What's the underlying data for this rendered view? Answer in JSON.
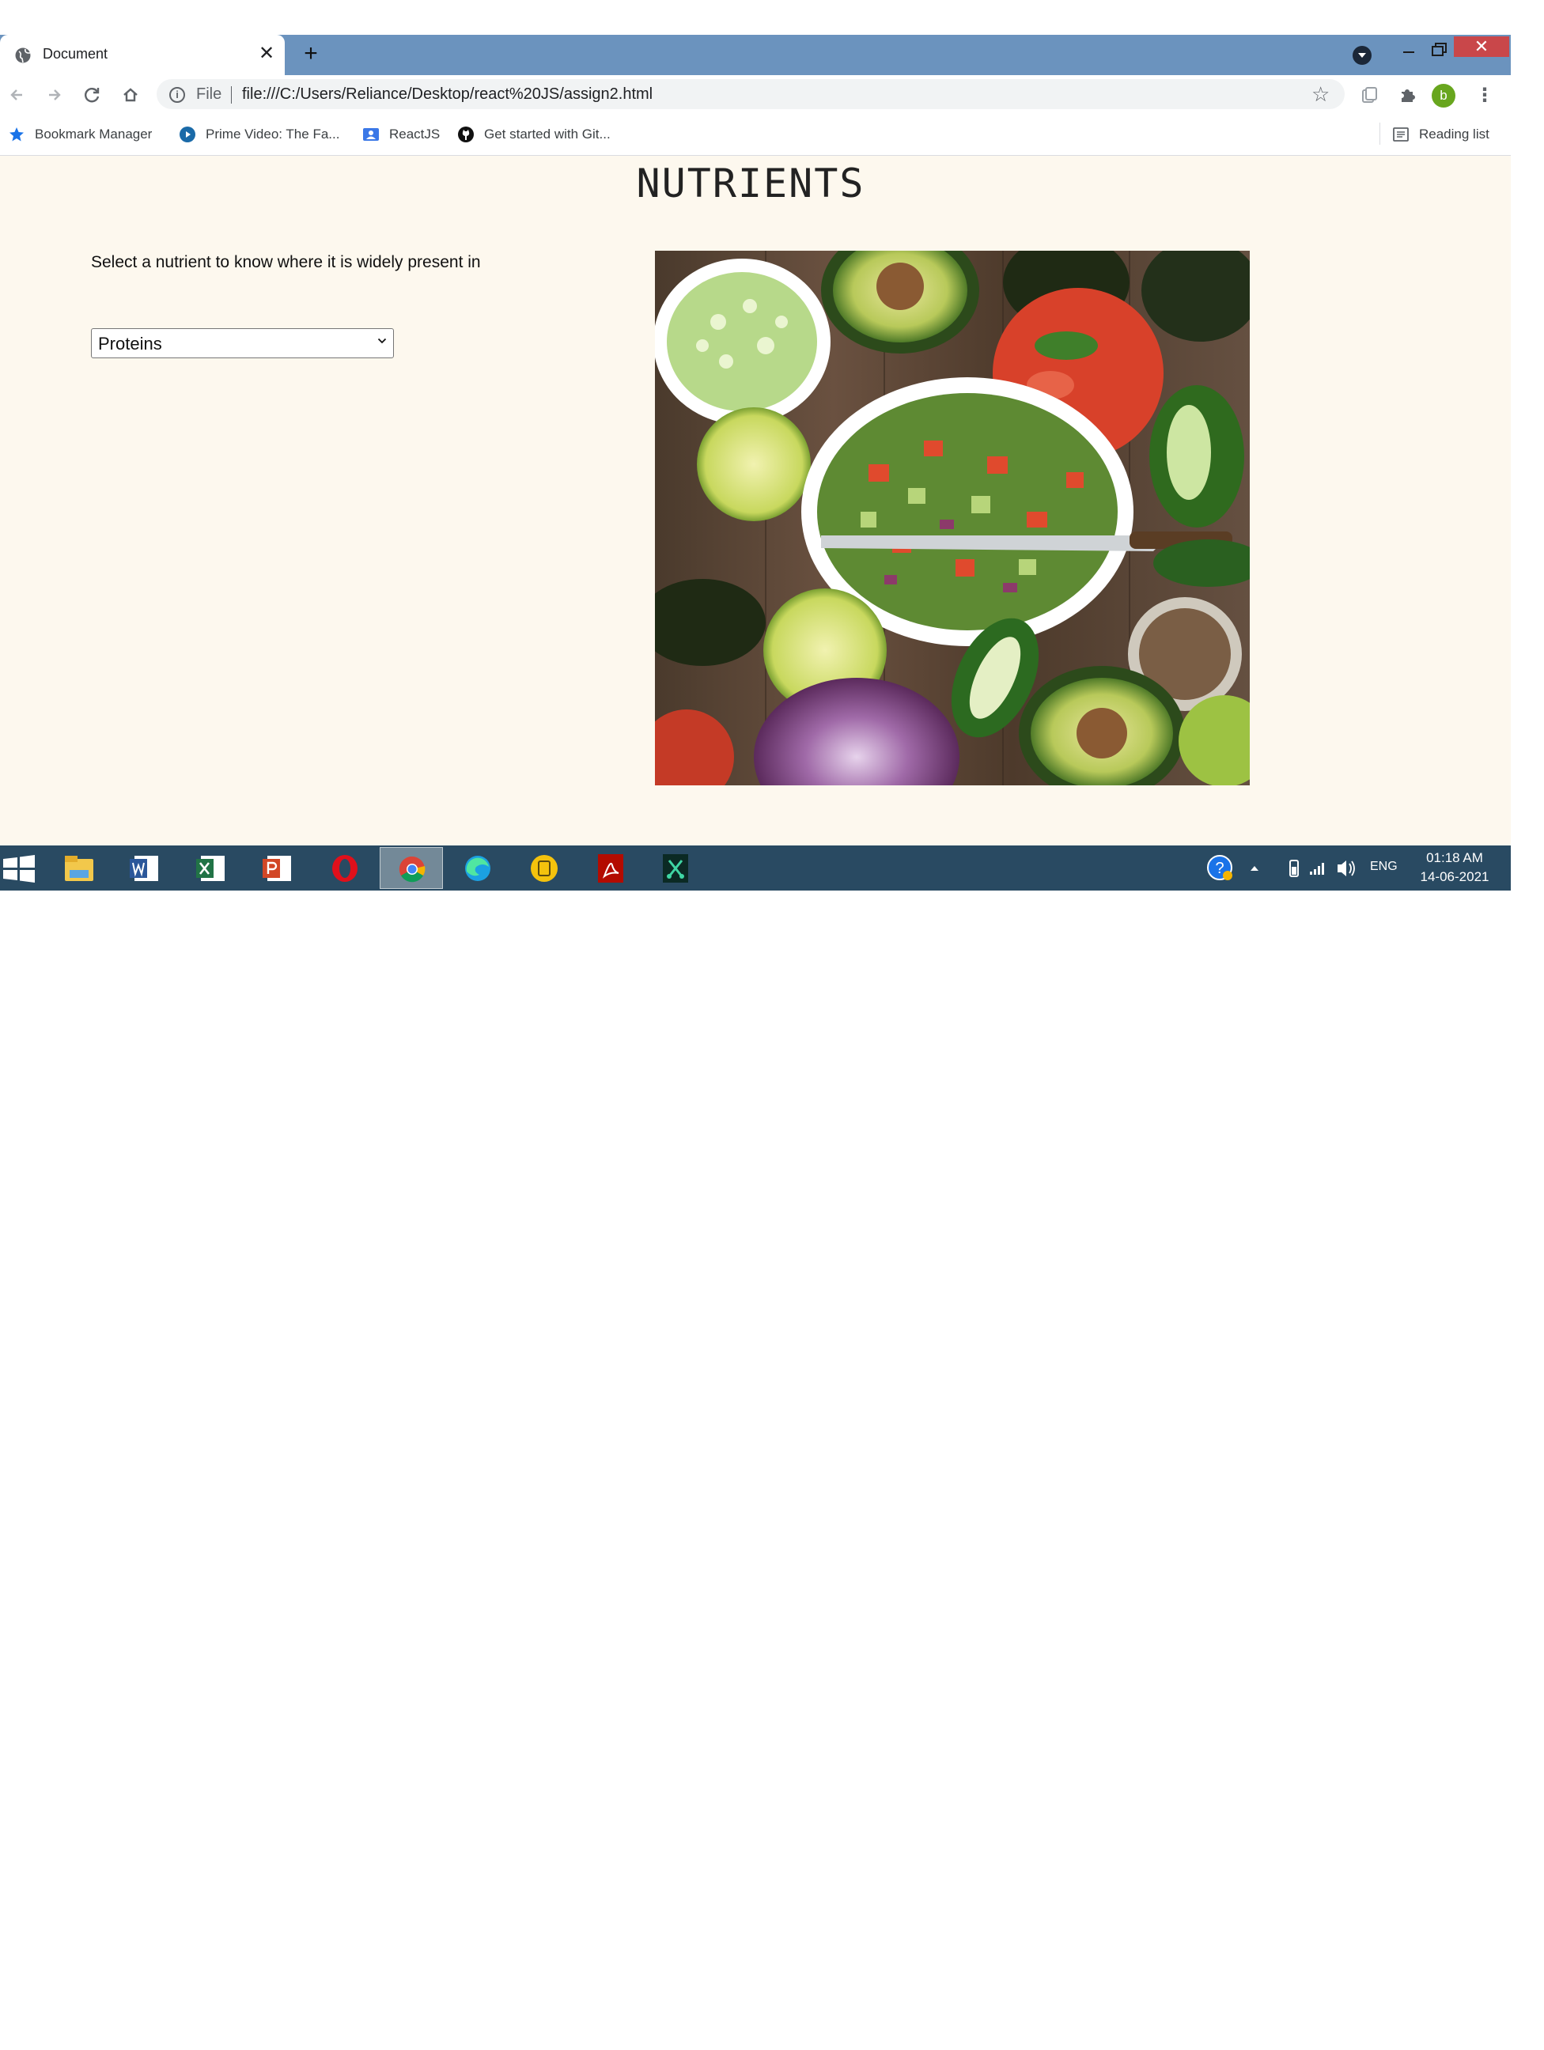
{
  "browser": {
    "tab": {
      "title": "Document",
      "close_glyph": "✕",
      "favicon": "globe-icon"
    },
    "new_tab_glyph": "+",
    "window_controls": {
      "close_glyph": "✕"
    },
    "toolbar": {
      "scheme": "File",
      "url": "file:///C:/Users/Reliance/Desktop/react%20JS/assign2.html",
      "info_glyph": "i",
      "star_glyph": "☆",
      "menu_glyph": "⋮",
      "profile_initial": "b"
    },
    "bookmarks": [
      {
        "label": "Bookmark Manager",
        "icon": "star-icon"
      },
      {
        "label": "Prime Video: The Fa...",
        "icon": "play-icon"
      },
      {
        "label": "ReactJS",
        "icon": "contact-icon"
      },
      {
        "label": "Get started with Git...",
        "icon": "github-icon"
      }
    ],
    "reading_list": "Reading list"
  },
  "page": {
    "title": "NUTRIENTS",
    "instruction": "Select a nutrient to know where it is widely present in",
    "select": {
      "value": "Proteins"
    },
    "image": {
      "alt": "food-salad-photo"
    }
  },
  "taskbar": {
    "apps": [
      "file-explorer",
      "word",
      "excel",
      "powerpoint",
      "opera",
      "chrome",
      "edge",
      "files-go",
      "acrobat",
      "snipping-tool"
    ],
    "active_app": "chrome",
    "language": "ENG",
    "time": "01:18 AM",
    "date": "14-06-2021"
  },
  "colors": {
    "tabstrip": "#6b93be",
    "page_bg": "#fdf8ee",
    "taskbar": "#294a62",
    "close_red": "#c9474a",
    "avatar_green": "#68a61e"
  }
}
